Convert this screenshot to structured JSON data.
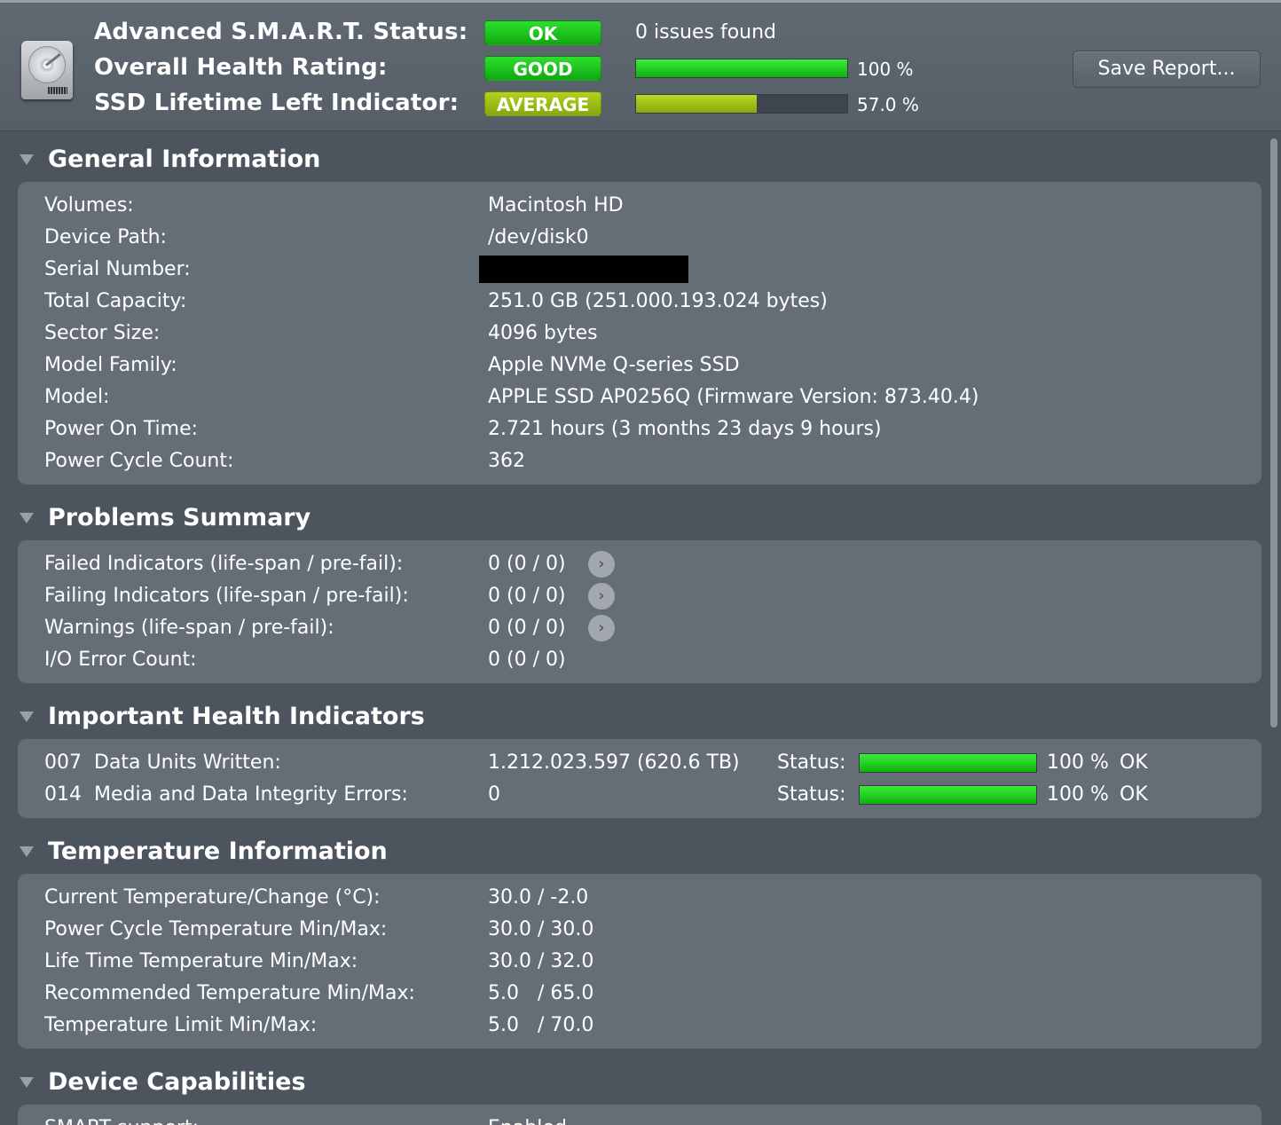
{
  "header": {
    "labels": {
      "smart_status": "Advanced S.M.A.R.T. Status:",
      "health_rating": "Overall Health Rating:",
      "lifetime": "SSD Lifetime Left Indicator:"
    },
    "smart_status_badge": "OK",
    "issues_text": "0 issues found",
    "health_badge": "GOOD",
    "health_percent": 100,
    "health_percent_text": "100 %",
    "lifetime_badge": "AVERAGE",
    "lifetime_percent": 57.0,
    "lifetime_percent_text": "57.0 %",
    "save_button": "Save Report...",
    "colors": {
      "good": "#1cc41c",
      "average": "#9ec016"
    }
  },
  "sections": {
    "general": {
      "title": "General Information",
      "rows": [
        {
          "label": "Volumes:",
          "value": "Macintosh HD"
        },
        {
          "label": "Device Path:",
          "value": "/dev/disk0"
        },
        {
          "label": "Serial Number:",
          "value": ""
        },
        {
          "label": "Total Capacity:",
          "value": "251.0 GB (251.000.193.024 bytes)"
        },
        {
          "label": "Sector Size:",
          "value": "4096 bytes"
        },
        {
          "label": "Model Family:",
          "value": "Apple NVMe Q-series SSD"
        },
        {
          "label": "Model:",
          "value": "APPLE SSD AP0256Q  (Firmware Version: 873.40.4)"
        },
        {
          "label": "Power On Time:",
          "value": "2.721 hours (3 months 23 days 9 hours)"
        },
        {
          "label": "Power Cycle Count:",
          "value": "362"
        }
      ]
    },
    "problems": {
      "title": "Problems Summary",
      "rows": [
        {
          "label": "Failed Indicators (life-span / pre-fail):",
          "value": "0  (0 / 0)"
        },
        {
          "label": "Failing Indicators (life-span / pre-fail):",
          "value": "0  (0 / 0)"
        },
        {
          "label": "Warnings (life-span / pre-fail):",
          "value": "0  (0 / 0)"
        },
        {
          "label": "I/O Error Count:",
          "value": "0  (0 / 0)"
        }
      ],
      "arrow_glyph": "›"
    },
    "health": {
      "title": "Important Health Indicators",
      "rows": [
        {
          "id": "007",
          "label": "Data Units Written:",
          "value": "1.212.023.597 (620.6 TB)",
          "status_label": "Status:",
          "percent": 100,
          "percent_text": "100 %",
          "status": "OK"
        },
        {
          "id": "014",
          "label": "Media and Data Integrity Errors:",
          "value": "0",
          "status_label": "Status:",
          "percent": 100,
          "percent_text": "100 %",
          "status": "OK"
        }
      ]
    },
    "temperature": {
      "title": "Temperature Information",
      "rows": [
        {
          "label": "Current Temperature/Change (°C):",
          "value": "30.0 / -2.0"
        },
        {
          "label": "Power Cycle Temperature Min/Max:",
          "value": "30.0 / 30.0"
        },
        {
          "label": "Life Time Temperature Min/Max:",
          "value": "30.0 / 32.0"
        },
        {
          "label": "Recommended Temperature Min/Max:",
          "value": "5.0   / 65.0"
        },
        {
          "label": "Temperature Limit Min/Max:",
          "value": "5.0   / 70.0"
        }
      ]
    },
    "capabilities": {
      "title": "Device Capabilities",
      "rows": [
        {
          "label": "SMART support:",
          "value": "Enabled"
        }
      ]
    }
  }
}
